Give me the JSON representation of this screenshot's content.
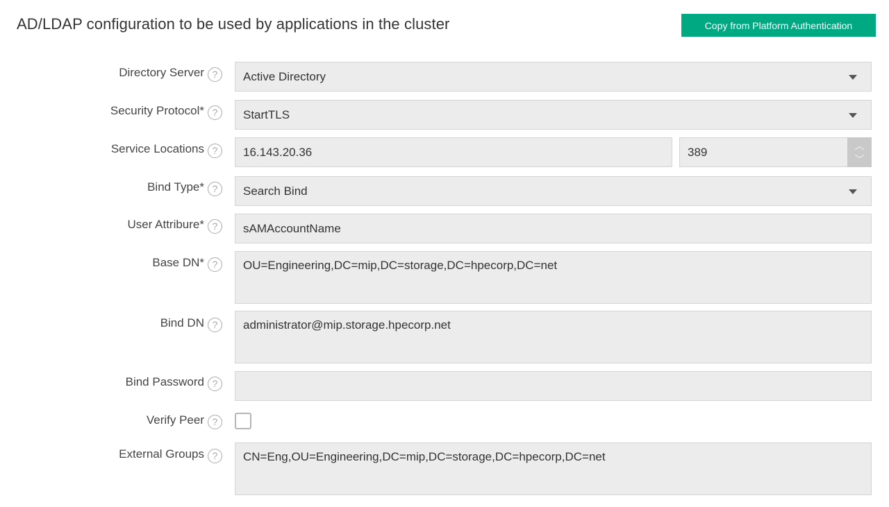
{
  "header": {
    "title": "AD/LDAP configuration to be used by applications in the cluster",
    "copy_button_label": "Copy from Platform Authentication",
    "accent_color": "#01a982"
  },
  "form": {
    "help_icon_glyph": "?",
    "directory_server": {
      "label": "Directory Server",
      "value": "Active Directory"
    },
    "security_protocol": {
      "label": "Security Protocol*",
      "value": "StartTLS"
    },
    "service_locations": {
      "label": "Service Locations",
      "host": "16.143.20.36",
      "port": "389",
      "spinner_up": "︿",
      "spinner_down": "﹀"
    },
    "bind_type": {
      "label": "Bind Type*",
      "value": "Search Bind"
    },
    "user_attribute": {
      "label": "User Attribure*",
      "value": "sAMAccountName"
    },
    "base_dn": {
      "label": "Base DN*",
      "value": "OU=Engineering,DC=mip,DC=storage,DC=hpecorp,DC=net"
    },
    "bind_dn": {
      "label": "Bind DN",
      "value": "administrator@mip.storage.hpecorp.net"
    },
    "bind_password": {
      "label": "Bind Password",
      "value": ""
    },
    "verify_peer": {
      "label": "Verify Peer",
      "checked": false
    },
    "external_groups": {
      "label": "External Groups",
      "value": "CN=Eng,OU=Engineering,DC=mip,DC=storage,DC=hpecorp,DC=net"
    }
  }
}
